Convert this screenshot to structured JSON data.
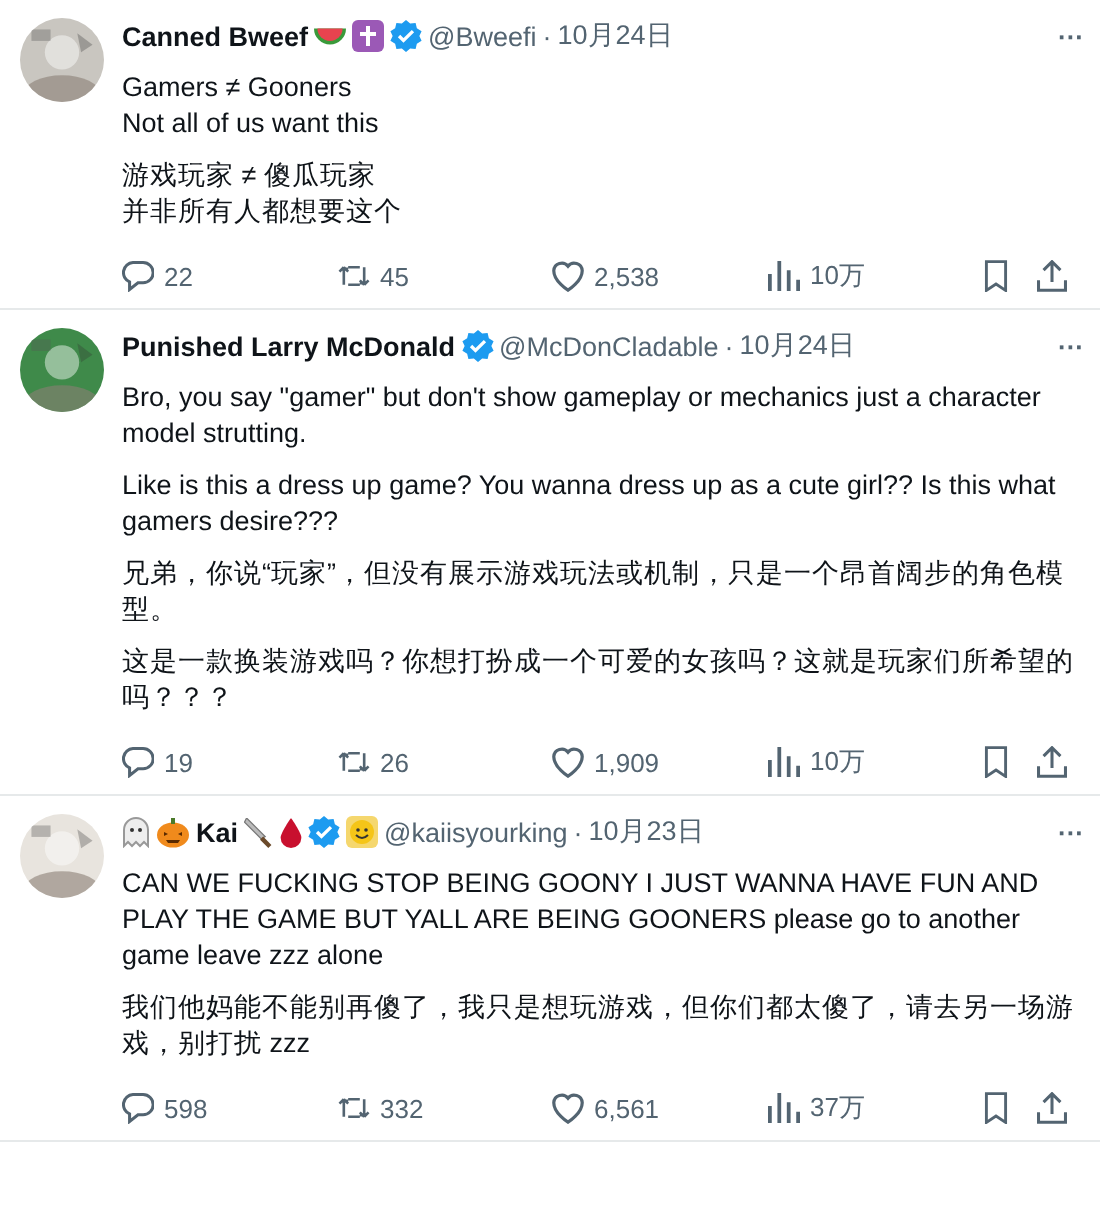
{
  "tweets": [
    {
      "name": "Canned Bweef",
      "verified": true,
      "handle": "@Bweefi",
      "dot": "·",
      "date": "10月24日",
      "more": "···",
      "blocks": [
        [
          "Gamers ≠ Gooners",
          "Not all of us want this"
        ],
        [
          "游戏玩家 ≠ 傻瓜玩家",
          "并非所有人都想要这个"
        ]
      ],
      "replies": "22",
      "reposts": "45",
      "likes": "2,538",
      "views": "10万"
    },
    {
      "name": "Punished Larry McDonald",
      "verified": true,
      "handle": "@McDonCladable",
      "dot": "·",
      "date": "10月24日",
      "more": "···",
      "blocks": [
        [
          "Bro, you say \"gamer\" but don't show gameplay or mechanics just a character model strutting."
        ],
        [
          "Like is this a dress up game? You wanna dress up as a cute girl?? Is this what gamers desire???"
        ],
        [
          "兄弟，你说“玩家”，但没有展示游戏玩法或机制，只是一个昂首阔步的角色模型。"
        ],
        [
          "这是一款换装游戏吗？你想打扮成一个可爱的女孩吗？这就是玩家们所希望的吗？？？"
        ]
      ],
      "replies": "19",
      "reposts": "26",
      "likes": "1,909",
      "views": "10万"
    },
    {
      "name": "Kai",
      "verified": true,
      "handle": "@kaiisyourking",
      "dot": "·",
      "date": "10月23日",
      "more": "···",
      "blocks": [
        [
          "CAN WE FUCKING STOP BEING GOONY I JUST WANNA HAVE FUN AND PLAY THE GAME BUT YALL ARE BEING GOONERS please go to another game leave zzz alone"
        ],
        [
          "我们他妈能不能别再傻了，我只是想玩游戏，但你们都太傻了，请去另一场游戏，别打扰 zzz"
        ]
      ],
      "replies": "598",
      "reposts": "332",
      "likes": "6,561",
      "views": "37万"
    }
  ]
}
